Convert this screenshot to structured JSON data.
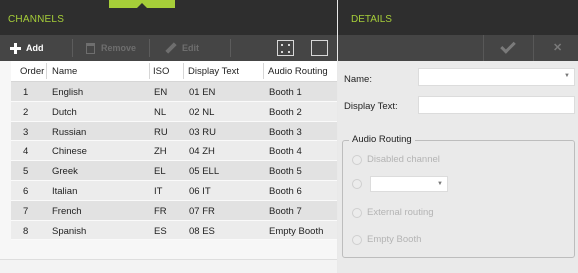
{
  "channels": {
    "title": "CHANNELS",
    "toolbar": {
      "add": "Add",
      "remove": "Remove",
      "edit": "Edit"
    },
    "columns": [
      "Order",
      "Name",
      "ISO",
      "Display Text",
      "Audio Routing"
    ],
    "rows": [
      [
        "1",
        "English",
        "EN",
        "01 EN",
        "Booth 1"
      ],
      [
        "2",
        "Dutch",
        "NL",
        "02 NL",
        "Booth 2"
      ],
      [
        "3",
        "Russian",
        "RU",
        "03 RU",
        "Booth 3"
      ],
      [
        "4",
        "Chinese",
        "ZH",
        "04 ZH",
        "Booth 4"
      ],
      [
        "5",
        "Greek",
        "EL",
        "05 ELL",
        "Booth 5"
      ],
      [
        "6",
        "Italian",
        "IT",
        "06 IT",
        "Booth 6"
      ],
      [
        "7",
        "French",
        "FR",
        "07 FR",
        "Booth 7"
      ],
      [
        "8",
        "Spanish",
        "ES",
        "08 ES",
        "Empty Booth"
      ]
    ]
  },
  "details": {
    "title": "DETAILS",
    "name_label": "Name:",
    "display_text_label": "Display Text:",
    "audio_routing": {
      "legend": "Audio Routing",
      "options": [
        "Disabled channel",
        "External routing",
        "Empty Booth"
      ]
    }
  },
  "colors": {
    "accent": "#a6ce39",
    "header_bg": "#2e2e2e",
    "toolbar_bg": "#454545"
  },
  "icons": [
    "plus-icon",
    "trash-icon",
    "pencil-icon",
    "select-all-icon",
    "select-none-icon",
    "checkmark-icon",
    "close-icon"
  ]
}
